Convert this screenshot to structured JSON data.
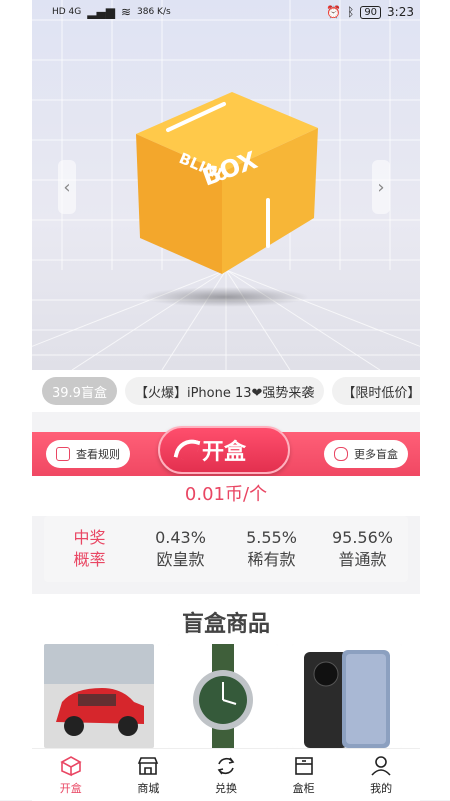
{
  "status_bar": {
    "network_left": "HD 4G",
    "speed": "386 K/s",
    "battery": "90",
    "time": "3:23"
  },
  "hero": {
    "box_text_line1": "BLIND",
    "box_text_line2": "BOX",
    "left_arrow_icon": "chevron-left-icon",
    "right_arrow_icon": "chevron-right-icon"
  },
  "chips": [
    {
      "label": "39.9盲盒",
      "active": true
    },
    {
      "label": "【火爆】iPhone 13❤强势来袭"
    },
    {
      "label": "【限时低价】社"
    }
  ],
  "action_bar": {
    "rules_label": "查看规则",
    "open_label": "开盒",
    "more_label": "更多盲盒"
  },
  "price_label": "0.01币/个",
  "probability": {
    "title_line1": "中奖",
    "title_line2": "概率",
    "items": [
      {
        "percent": "0.43%",
        "name": "欧皇款"
      },
      {
        "percent": "5.55%",
        "name": "稀有款"
      },
      {
        "percent": "95.56%",
        "name": "普通款"
      }
    ]
  },
  "goods": {
    "title": "盲盒商品",
    "products": [
      {
        "icon": "red-car-image"
      },
      {
        "icon": "green-watch-image"
      },
      {
        "icon": "smartphone-image"
      }
    ]
  },
  "tabbar": {
    "items": [
      {
        "label": "开盒",
        "icon": "box-icon",
        "active": true
      },
      {
        "label": "商城",
        "icon": "store-icon"
      },
      {
        "label": "兑换",
        "icon": "exchange-icon"
      },
      {
        "label": "盒柜",
        "icon": "cabinet-icon"
      },
      {
        "label": "我的",
        "icon": "user-icon"
      }
    ]
  },
  "colors": {
    "accent": "#e94663",
    "box": "#f6b43a"
  }
}
